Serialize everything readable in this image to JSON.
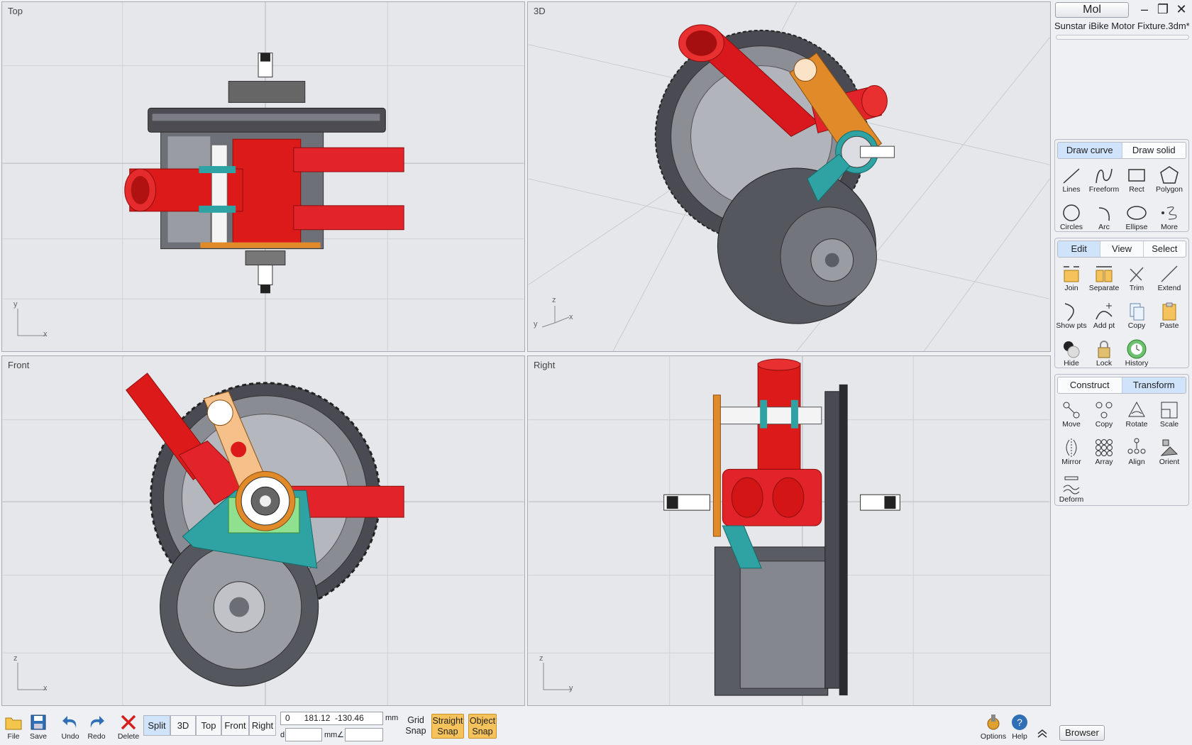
{
  "viewports": {
    "top": {
      "title": "Top",
      "axis_a": "y",
      "axis_b": "x"
    },
    "persp": {
      "title": "3D",
      "axis_a": "y",
      "axis_b": "z",
      "axis_c": "x"
    },
    "front": {
      "title": "Front",
      "axis_a": "z",
      "axis_b": "x"
    },
    "right": {
      "title": "Right",
      "axis_a": "z",
      "axis_b": "y"
    }
  },
  "app": {
    "user_button": "Mol",
    "file_name": "Sunstar iBike Motor Fixture.3dm*"
  },
  "draw_group": {
    "tabs": [
      {
        "label": "Draw curve",
        "active": true
      },
      {
        "label": "Draw solid",
        "active": false
      }
    ],
    "tools": [
      {
        "label": "Lines",
        "icon": "line-icon"
      },
      {
        "label": "Freeform",
        "icon": "freeform-icon"
      },
      {
        "label": "Rect",
        "icon": "rect-icon"
      },
      {
        "label": "Polygon",
        "icon": "polygon-icon"
      },
      {
        "label": "Circles",
        "icon": "circle-icon"
      },
      {
        "label": "Arc",
        "icon": "arc-icon"
      },
      {
        "label": "Ellipse",
        "icon": "ellipse-icon"
      },
      {
        "label": "More",
        "icon": "more-icon"
      }
    ]
  },
  "edit_group": {
    "tabs": [
      {
        "label": "Edit",
        "active": true
      },
      {
        "label": "View",
        "active": false
      },
      {
        "label": "Select",
        "active": false
      }
    ],
    "tools": [
      {
        "label": "Join",
        "icon": "join-icon"
      },
      {
        "label": "Separate",
        "icon": "separate-icon"
      },
      {
        "label": "Trim",
        "icon": "trim-icon"
      },
      {
        "label": "Extend",
        "icon": "extend-icon"
      },
      {
        "label": "Show pts",
        "icon": "show-points-icon"
      },
      {
        "label": "Add pt",
        "icon": "add-point-icon"
      },
      {
        "label": "Copy",
        "icon": "copy-icon"
      },
      {
        "label": "Paste",
        "icon": "paste-icon"
      },
      {
        "label": "Hide",
        "icon": "hide-icon"
      },
      {
        "label": "Lock",
        "icon": "lock-icon"
      },
      {
        "label": "History",
        "icon": "history-icon"
      }
    ]
  },
  "transform_group": {
    "tabs": [
      {
        "label": "Construct",
        "active": false
      },
      {
        "label": "Transform",
        "active": true
      }
    ],
    "tools": [
      {
        "label": "Move",
        "icon": "move-icon"
      },
      {
        "label": "Copy",
        "icon": "copy-transform-icon"
      },
      {
        "label": "Rotate",
        "icon": "rotate-icon"
      },
      {
        "label": "Scale",
        "icon": "scale-icon"
      },
      {
        "label": "Mirror",
        "icon": "mirror-icon"
      },
      {
        "label": "Array",
        "icon": "array-icon"
      },
      {
        "label": "Align",
        "icon": "align-icon"
      },
      {
        "label": "Orient",
        "icon": "orient-icon"
      },
      {
        "label": "Deform",
        "icon": "deform-icon"
      }
    ]
  },
  "bottom": {
    "file": "File",
    "save": "Save",
    "undo": "Undo",
    "redo": "Redo",
    "delete": "Delete",
    "views": [
      {
        "label": "Split",
        "active": true
      },
      {
        "label": "3D",
        "active": false
      },
      {
        "label": "Top",
        "active": false
      },
      {
        "label": "Front",
        "active": false
      },
      {
        "label": "Right",
        "active": false
      }
    ],
    "coords": "0      181.12  -130.46",
    "unit": "mm",
    "d_label": "d",
    "d_unit": "mm",
    "angle_symbol": "∠",
    "grid_snap": "Grid\nSnap",
    "straight_snap": "Straight\nSnap",
    "object_snap": "Object\nSnap",
    "options": "Options",
    "help": "Help",
    "browser": "Browser"
  },
  "colors": {
    "accent_tab": "#cfe3fb",
    "snap_on": "#f6c25c",
    "tube_red": "#dd1a1a",
    "arm_orange": "#e08a2a",
    "bracket_teal": "#2fa3a3"
  }
}
